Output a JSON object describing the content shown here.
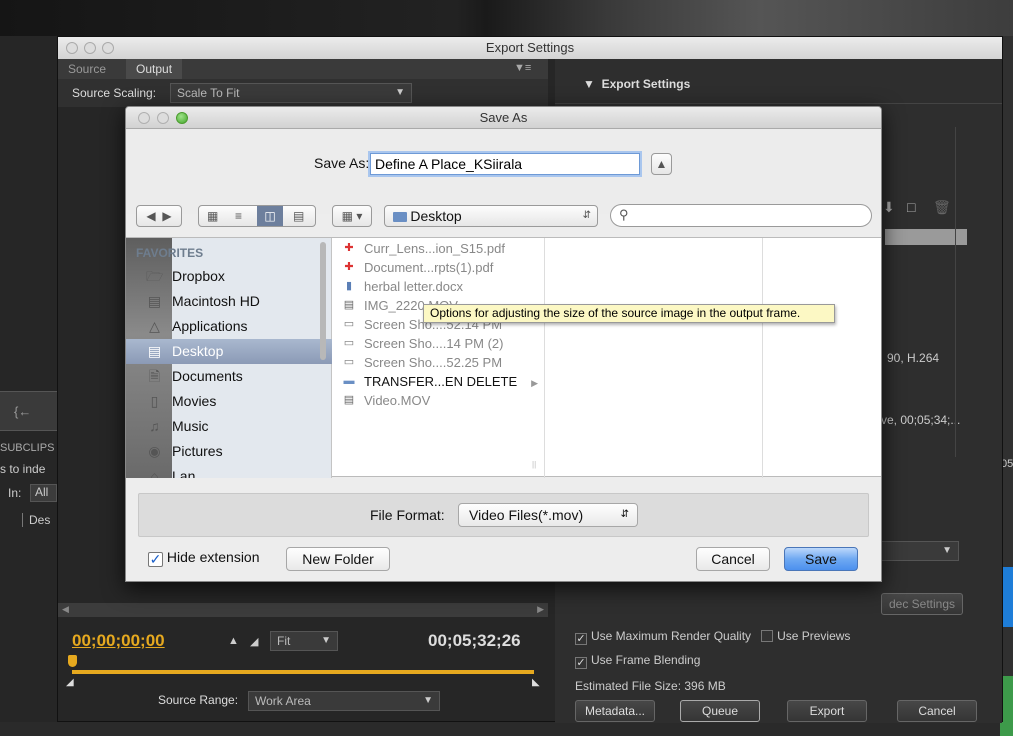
{
  "export_window": {
    "title": "Export Settings",
    "tabs": [
      "Source",
      "Output"
    ],
    "source_scaling_label": "Source Scaling:",
    "source_scaling_value": "Scale To Fit",
    "export_settings_header": "Export Settings",
    "summary_codec": "90, H.264",
    "summary_timecode": "ve, 00;05;34;...",
    "codec_settings_btn": "dec Settings",
    "current_timecode": "00;00;00;00",
    "fit_label": "Fit",
    "duration_timecode": "00;05;32;26",
    "source_range_label": "Source Range:",
    "source_range_value": "Work Area",
    "use_max_render_quality": "Use Maximum Render Quality",
    "use_previews": "Use Previews",
    "use_frame_blending": "Use Frame Blending",
    "estimated_file_size": "Estimated File Size: 396 MB",
    "buttons": {
      "metadata": "Metadata...",
      "queue": "Queue",
      "export": "Export",
      "cancel": "Cancel"
    },
    "left_panel_labels": {
      "subclips": "SUBCLIPS",
      "to_index": "s to inde",
      "in": "In:",
      "all": "All",
      "desc": "Des"
    },
    "right_number": "05"
  },
  "save_dialog": {
    "title": "Save As",
    "save_as_label": "Save As:",
    "filename": "Define A Place_KSiirala",
    "location": "Desktop",
    "search_placeholder": "",
    "favorites_header": "FAVORITES",
    "sidebar": [
      {
        "label": "Dropbox",
        "icon": "folder-icon"
      },
      {
        "label": "Macintosh HD",
        "icon": "hard-drive-icon"
      },
      {
        "label": "Applications",
        "icon": "applications-icon"
      },
      {
        "label": "Desktop",
        "icon": "desktop-icon",
        "selected": true
      },
      {
        "label": "Documents",
        "icon": "documents-icon"
      },
      {
        "label": "Movies",
        "icon": "movies-icon"
      },
      {
        "label": "Music",
        "icon": "music-icon"
      },
      {
        "label": "Pictures",
        "icon": "pictures-icon"
      },
      {
        "label": "Lan...",
        "icon": "home-icon"
      }
    ],
    "files": [
      {
        "name": "Curr_Lens...ion_S15.pdf",
        "icon": "pdf-icon"
      },
      {
        "name": "Document...rpts(1).pdf",
        "icon": "pdf-icon"
      },
      {
        "name": "herbal letter.docx",
        "icon": "document-icon"
      },
      {
        "name": "IMG_2220.MOV",
        "icon": "video-icon"
      },
      {
        "name": "Screen Sho....52.14 PM",
        "icon": "image-icon"
      },
      {
        "name": "Screen Sho....14 PM (2)",
        "icon": "image-icon"
      },
      {
        "name": "Screen Sho....52.25 PM",
        "icon": "image-icon"
      },
      {
        "name": "TRANSFER...EN DELETE",
        "icon": "folder-icon",
        "folder": true
      },
      {
        "name": "Video.MOV",
        "icon": "video-icon"
      }
    ],
    "file_format_label": "File Format:",
    "file_format_value": "Video Files(*.mov)",
    "hide_extension_label": "Hide extension",
    "hide_extension_checked": true,
    "new_folder_btn": "New Folder",
    "cancel_btn": "Cancel",
    "save_btn": "Save"
  },
  "tooltip": "Options for adjusting the size of the source image in the output frame.",
  "colors": {
    "accent_blue": "#3d82f0",
    "timecode_orange": "#e6a91f",
    "sidebar_selected": "#8b9ab6"
  }
}
